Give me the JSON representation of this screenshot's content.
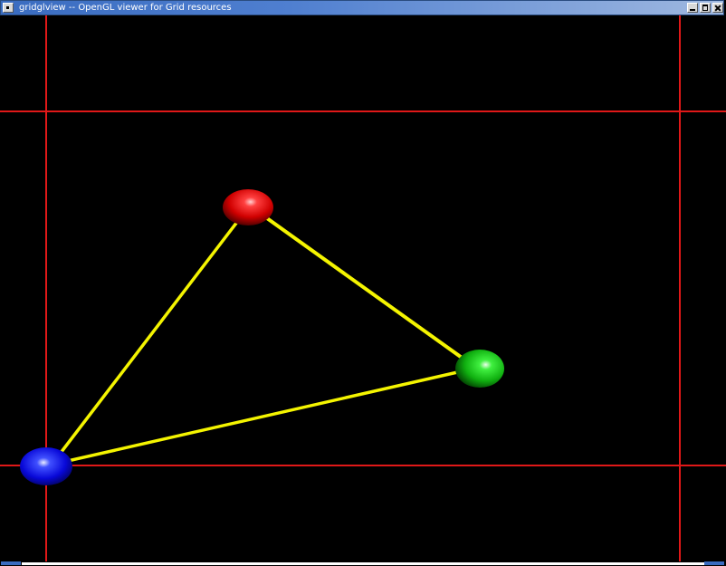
{
  "window": {
    "title": "gridglview -- OpenGL viewer for Grid resources",
    "icons": {
      "system_menu": "window-menu-icon",
      "minimize": "minimize-icon",
      "maximize": "maximize-icon",
      "close": "close-icon"
    }
  },
  "scene": {
    "background": "#000000",
    "grid_color": "#e01818",
    "link_color": "#f0f000",
    "nodes": [
      {
        "name": "red-node",
        "color": "#e00000",
        "highlight": "#ffb0b0"
      },
      {
        "name": "green-node",
        "color": "#10c010",
        "highlight": "#c8ffc8"
      },
      {
        "name": "blue-node",
        "color": "#1010e8",
        "highlight": "#c0c8ff"
      }
    ],
    "links": [
      {
        "from": "red-node",
        "to": "green-node"
      },
      {
        "from": "red-node",
        "to": "blue-node"
      },
      {
        "from": "green-node",
        "to": "blue-node"
      }
    ]
  }
}
